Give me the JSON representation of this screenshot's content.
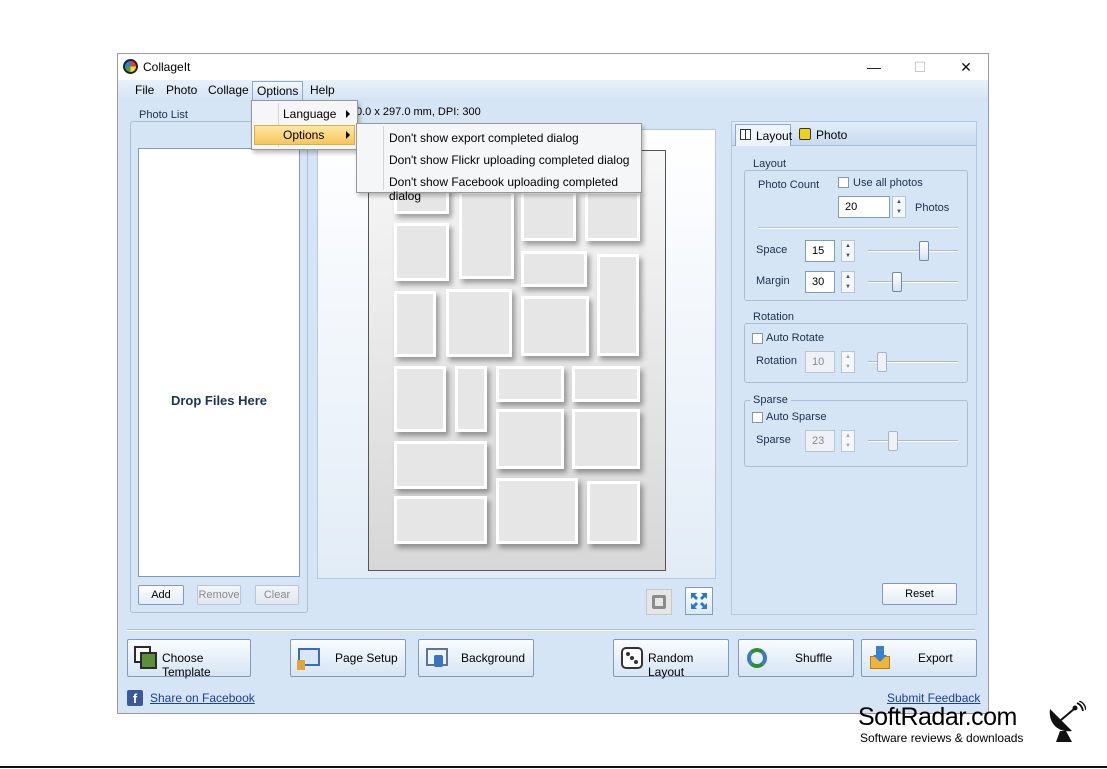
{
  "window": {
    "title": "CollageIt",
    "minimize": "—",
    "maximize": "☐",
    "close": "✕"
  },
  "menubar": [
    "File",
    "Photo",
    "Collage",
    "Options",
    "Help"
  ],
  "options_menu": {
    "items": [
      "Language",
      "Options"
    ],
    "submenu": [
      "Don't show export completed dialog",
      "Don't show Flickr uploading completed dialog",
      "Don't show Facebook uploading completed dialog"
    ]
  },
  "photo_list": {
    "group_label": "Photo List",
    "drop_text": "Drop Files Here",
    "add": "Add",
    "remove": "Remove",
    "clear": "Clear"
  },
  "page_info": "0.0 x 297.0 mm, DPI: 300",
  "tabs": [
    {
      "label": "Layout",
      "icon": "layout-grid-icon",
      "active": true
    },
    {
      "label": "Photo",
      "icon": "photo-dice-icon",
      "active": false
    }
  ],
  "layout_panel": {
    "layout_group": "Layout",
    "photo_count_label": "Photo Count",
    "use_all_photos": "Use all photos",
    "use_all_photos_checked": false,
    "photo_count": "20",
    "photos_unit": "Photos",
    "space_label": "Space",
    "space_value": "15",
    "margin_label": "Margin",
    "margin_value": "30",
    "rotation_group": "Rotation",
    "auto_rotate": "Auto Rotate",
    "rotation_label": "Rotation",
    "rotation_value": "10",
    "sparse_group": "Sparse",
    "auto_sparse": "Auto Sparse",
    "sparse_label": "Sparse",
    "sparse_value": "23",
    "reset": "Reset"
  },
  "bottom_buttons": {
    "choose_template": "Choose Template",
    "page_setup": "Page Setup",
    "background": "Background",
    "random_layout": "Random Layout",
    "shuffle": "Shuffle",
    "export": "Export"
  },
  "links": {
    "share_facebook": "Share on Facebook",
    "submit_feedback": "Submit Feedback"
  },
  "watermark": {
    "brand": "SoftRadar.com",
    "tagline": "Software reviews & downloads"
  },
  "colors": {
    "window_bg": "#d6e5f5",
    "menu_highlight": "#f8c55a",
    "link": "#1a3f9e"
  }
}
